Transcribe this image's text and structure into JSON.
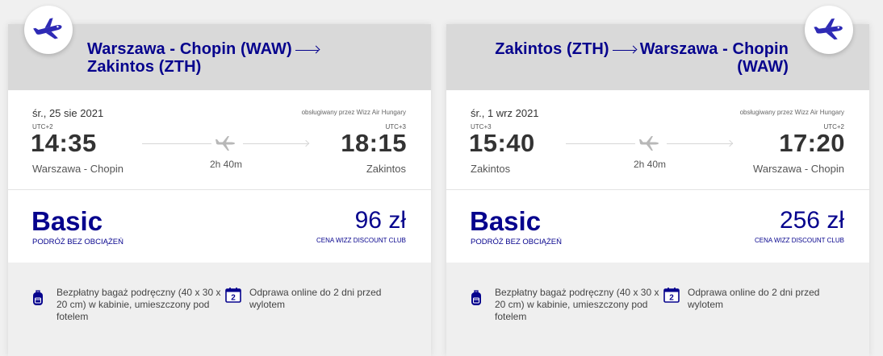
{
  "flights": [
    {
      "route_from": "Warszawa - Chopin (WAW)",
      "route_to": "Zakintos (ZTH)",
      "date": "śr., 25 sie 2021",
      "operated_by": "obsługiwany przez Wizz Air Hungary",
      "dep_tz": "UTC+2",
      "arr_tz": "UTC+3",
      "dep_time": "14:35",
      "arr_time": "18:15",
      "dep_city": "Warszawa - Chopin",
      "arr_city": "Zakintos",
      "duration": "2h 40m",
      "fare_name": "Basic",
      "fare_sub": "PODRÓŻ BEZ OBCIĄŻEŃ",
      "price": "96 zł",
      "price_sub": "CENA WIZZ DISCOUNT CLUB",
      "benefit_bag": "Bezpłatny bagaż podręczny (40 x 30 x 20 cm) w kabinie, umieszczony pod fotelem",
      "benefit_checkin": "Odprawa online do 2 dni przed wylotem",
      "badge_icon": "plane-takeoff-icon"
    },
    {
      "route_from": "Zakintos (ZTH)",
      "route_to": "Warszawa - Chopin (WAW)",
      "date": "śr., 1 wrz 2021",
      "operated_by": "obsługiwany przez Wizz Air Hungary",
      "dep_tz": "UTC+3",
      "arr_tz": "UTC+2",
      "dep_time": "15:40",
      "arr_time": "17:20",
      "dep_city": "Zakintos",
      "arr_city": "Warszawa - Chopin",
      "duration": "2h 40m",
      "fare_name": "Basic",
      "fare_sub": "PODRÓŻ BEZ OBCIĄŻEŃ",
      "price": "256 zł",
      "price_sub": "CENA WIZZ DISCOUNT CLUB",
      "benefit_bag": "Bezpłatny bagaż podręczny (40 x 30 x 20 cm) w kabinie, umieszczony pod fotelem",
      "benefit_checkin": "Odprawa online do 2 dni przed wylotem",
      "badge_icon": "plane-landing-icon"
    }
  ],
  "calendar_icon_day": "2",
  "colors": {
    "brand": "#06038d",
    "header_bg": "#d9d9d9",
    "text": "#333333"
  }
}
